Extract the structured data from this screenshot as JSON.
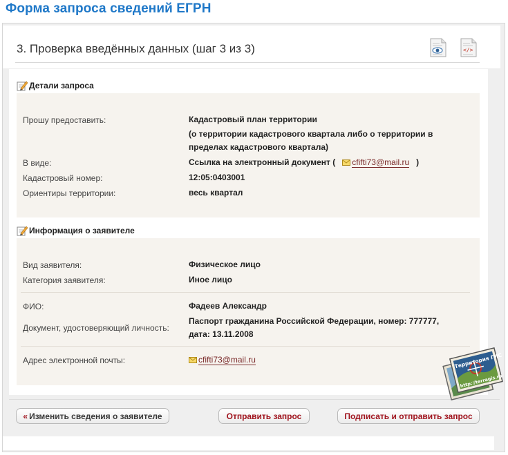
{
  "page": {
    "title": "Форма запроса сведений ЕГРН"
  },
  "step": {
    "title": "3. Проверка введённых данных (шаг 3 из 3)"
  },
  "details": {
    "heading": "Детали запроса",
    "request_label": "Прошу предоставить:",
    "request_value": "Кадастровый план территории",
    "request_note": "(о территории кадастрового квартала либо о территории в пределах кадастрового квартала)",
    "form_label": "В виде:",
    "form_value": "Ссылка на электронный документ (",
    "form_email": "cfifti73@mail.ru",
    "form_close": ")",
    "cadastral_label": "Кадастровый номер:",
    "cadastral_value": "12:05:0403001",
    "orient_label": "Ориентиры территории:",
    "orient_value": "весь квартал"
  },
  "applicant": {
    "heading": "Информация о заявителе",
    "type_label": "Вид заявителя:",
    "type_value": "Физическое лицо",
    "category_label": "Категория заявителя:",
    "category_value": "Иное лицо",
    "fio_label": "ФИО:",
    "fio_value": "Фадеев Александр",
    "doc_label": "Документ, удостоверяющий личность:",
    "doc_value": "Паспорт гражданина Российской Федерации, номер: 777777, дата: 13.11.2008",
    "email_label": "Адрес электронной почты:",
    "email_value": "cfifti73@mail.ru"
  },
  "buttons": {
    "back_arrow": "«",
    "back": "Изменить сведения о заявителе",
    "send": "Отправить запрос",
    "sign_send": "Подписать и отправить запрос"
  },
  "watermark": {
    "text1": "Территория ГИС",
    "text2": "http://terragis.ru"
  },
  "icons": {
    "view": "preview-document-icon",
    "xml": "xml-document-icon",
    "section": "edit-pencil-icon",
    "email": "envelope-icon"
  },
  "colors": {
    "title": "#1f78c8",
    "button_text": "#a0141e",
    "panel_bg": "#f6f3ee",
    "link": "#7a2a2a"
  }
}
